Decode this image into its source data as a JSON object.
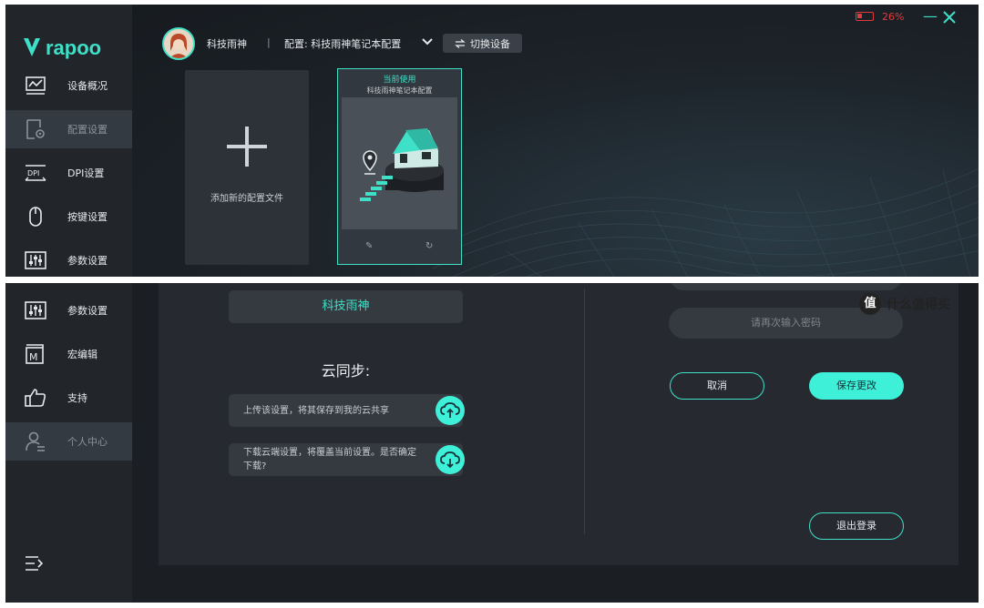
{
  "app": {
    "brand": "rapoo"
  },
  "header": {
    "user_name": "科技雨神",
    "separator": "|",
    "config_label": "配置: 科技雨神笔记本配置",
    "switch_device": "切换设备",
    "battery": "26%"
  },
  "sidebar_top": [
    {
      "label": "设备概况",
      "icon": "monitor-chart-icon"
    },
    {
      "label": "配置设置",
      "icon": "config-file-icon",
      "active": true
    },
    {
      "label": "DPI设置",
      "icon": "dpi-icon"
    },
    {
      "label": "按键设置",
      "icon": "mouse-icon"
    },
    {
      "label": "参数设置",
      "icon": "sliders-icon"
    }
  ],
  "profiles": {
    "add_label": "添加新的配置文件",
    "current_tag": "当前使用",
    "current_name": "科技雨神笔记本配置"
  },
  "sidebar_bottom": [
    {
      "label": "参数设置",
      "icon": "sliders-icon"
    },
    {
      "label": "宏编辑",
      "icon": "macro-icon"
    },
    {
      "label": "支持",
      "icon": "thumbs-up-icon"
    },
    {
      "label": "个人中心",
      "icon": "user-center-icon",
      "active": true
    }
  ],
  "account": {
    "name": "科技雨神",
    "cloud_sync_title": "云同步:",
    "upload_text": "上传该设置，将其保存到我的云共享",
    "download_text": "下载云端设置，将覆盖当前设置。是否确定下载?",
    "confirm_password_placeholder": "请再次输入密码",
    "cancel": "取消",
    "save": "保存更改",
    "logout": "退出登录"
  },
  "watermark": {
    "text": "什么值得买",
    "logo_char": "值"
  },
  "colors": {
    "accent": "#3fe0c8",
    "battery_low": "#e23a3a",
    "sidebar_bg": "#22262b"
  }
}
